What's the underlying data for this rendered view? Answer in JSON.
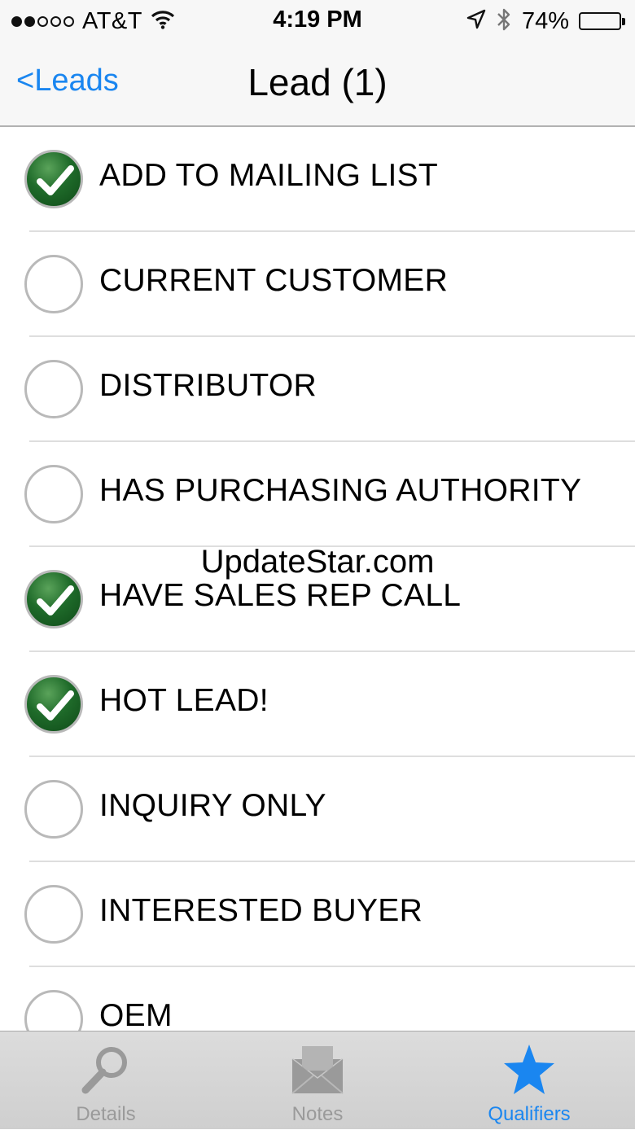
{
  "status_bar": {
    "signal_bars_filled": 2,
    "signal_bars_total": 5,
    "carrier": "AT&T",
    "time": "4:19 PM",
    "battery": "74%",
    "battery_level": 0.74,
    "icons": [
      "wifi-icon",
      "location-arrow-icon",
      "bluetooth-icon",
      "battery-icon"
    ]
  },
  "nav": {
    "back_label": "<Leads",
    "title": "Lead (1)"
  },
  "qualifiers": [
    {
      "label": "ADD TO MAILING LIST",
      "checked": true
    },
    {
      "label": "CURRENT CUSTOMER",
      "checked": false
    },
    {
      "label": "DISTRIBUTOR",
      "checked": false
    },
    {
      "label": "HAS PURCHASING AUTHORITY",
      "checked": false
    },
    {
      "label": "HAVE SALES REP CALL",
      "checked": true
    },
    {
      "label": "HOT LEAD!",
      "checked": true
    },
    {
      "label": "INQUIRY ONLY",
      "checked": false
    },
    {
      "label": "INTERESTED BUYER",
      "checked": false
    },
    {
      "label": "OEM",
      "checked": false
    }
  ],
  "watermark": "UpdateStar.com",
  "tabs": [
    {
      "label": "Details",
      "icon": "magnifier-icon",
      "active": false
    },
    {
      "label": "Notes",
      "icon": "envelope-icon",
      "active": false
    },
    {
      "label": "Qualifiers",
      "icon": "star-icon",
      "active": true
    }
  ],
  "colors": {
    "accent": "#1a86f0",
    "check_green": "#1f6b2a",
    "tab_inactive": "#9a9a9a"
  }
}
